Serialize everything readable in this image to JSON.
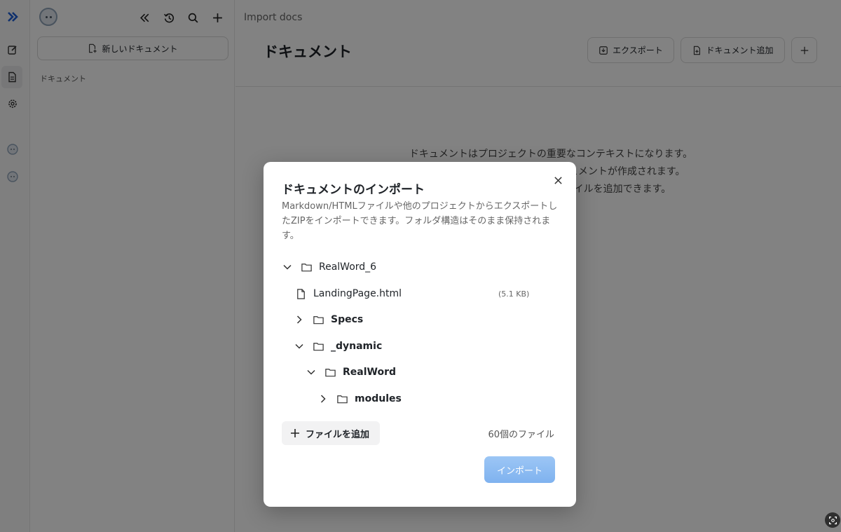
{
  "sidebar": {
    "new_doc_label": "新しいドキュメント",
    "section_label": "ドキュメント"
  },
  "header": {
    "breadcrumb": "Import docs",
    "title": "ドキュメント",
    "export_label": "エクスポート",
    "add_doc_label": "ドキュメント追加"
  },
  "empty_state": {
    "lines": [
      "ドキュメントはプロジェクトの重要なコンテキストになります。",
      "に ドキュメントが作成されます。",
      "ァイルを追加できます。"
    ]
  },
  "modal": {
    "title": "ドキュメントのインポート",
    "description": "Markdown/HTMLファイルや他のプロジェクトからエクスポートしたZIPをインポートできます。フォルダ構造はそのまま保持されます。",
    "tree": [
      {
        "name": "RealWord_6",
        "type": "folder",
        "expanded": true,
        "depth": 0
      },
      {
        "name": "LandingPage.html",
        "type": "file",
        "size": "(5.1 KB)",
        "depth": 1
      },
      {
        "name": "Specs",
        "type": "folder",
        "expanded": false,
        "depth": 1
      },
      {
        "name": "_dynamic",
        "type": "folder",
        "expanded": true,
        "depth": 1
      },
      {
        "name": "RealWord",
        "type": "folder",
        "expanded": true,
        "depth": 2
      },
      {
        "name": "modules",
        "type": "folder",
        "expanded": false,
        "depth": 3
      }
    ],
    "add_file_label": "ファイルを追加",
    "file_count": "60個のファイル",
    "import_label": "インポート"
  },
  "colors": {
    "accent": "#1f5fd6",
    "import_button": "#8bbcf2",
    "overlay": "#000000"
  },
  "icons": {
    "close": "close-icon",
    "folder": "folder-icon",
    "file": "file-icon",
    "chevron_down": "chevron-down-icon",
    "chevron_right": "chevron-right-icon",
    "plus": "plus-icon"
  }
}
